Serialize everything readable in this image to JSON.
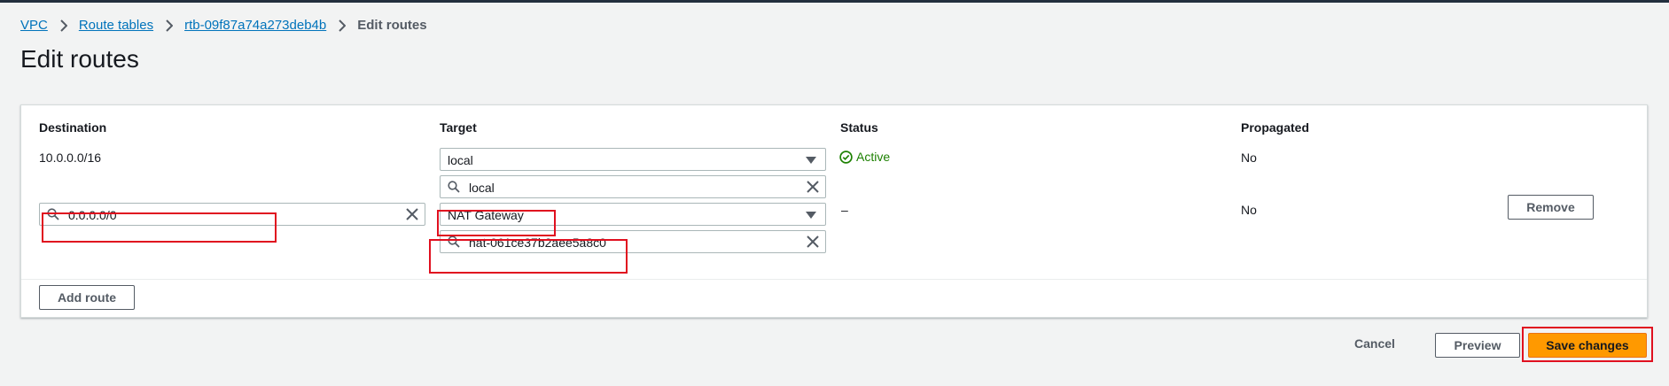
{
  "breadcrumb": {
    "items": [
      "VPC",
      "Route tables",
      "rtb-09f87a74a273deb4b"
    ],
    "current": "Edit routes"
  },
  "page": {
    "title": "Edit routes"
  },
  "table": {
    "headers": {
      "destination": "Destination",
      "target": "Target",
      "status": "Status",
      "propagated": "Propagated"
    },
    "rows": [
      {
        "destination": "10.0.0.0/16",
        "target_type": "local",
        "target_value": "local",
        "status": "Active",
        "propagated": "No"
      },
      {
        "destination": "0.0.0.0/0",
        "target_type": "NAT Gateway",
        "target_value": "nat-061ce37b2aee5a8c0",
        "status": "–",
        "propagated": "No",
        "remove_label": "Remove"
      }
    ],
    "add_route_label": "Add route"
  },
  "footer": {
    "cancel_label": "Cancel",
    "preview_label": "Preview",
    "save_label": "Save changes"
  },
  "colors": {
    "accent": "#ff9900",
    "link": "#0073bb",
    "highlight": "#e0101f",
    "success": "#1d8102"
  }
}
